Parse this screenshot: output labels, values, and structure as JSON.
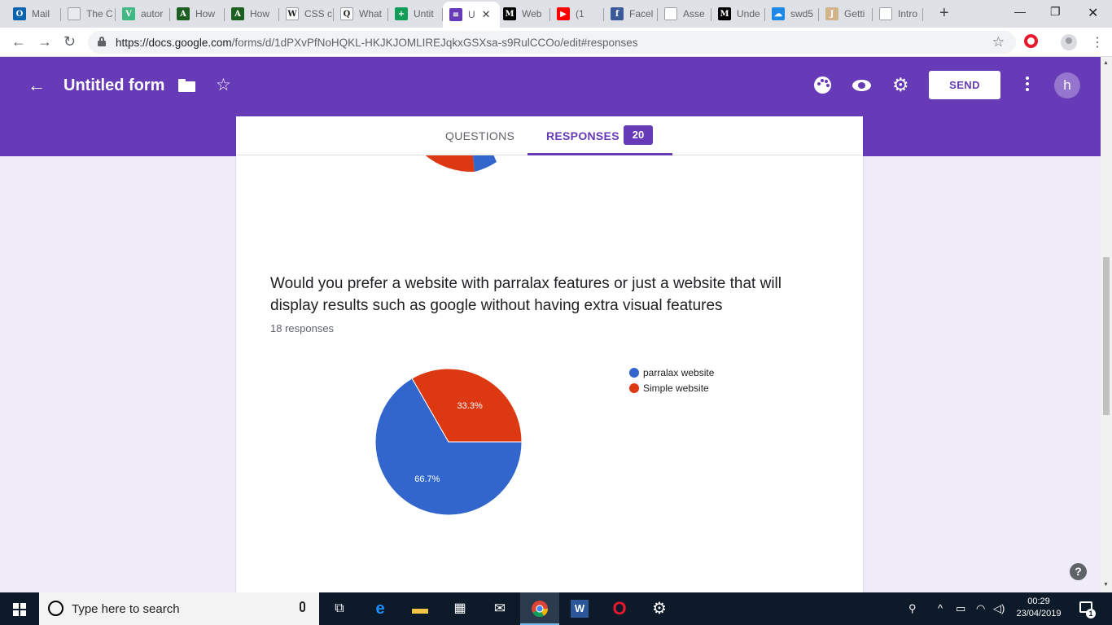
{
  "browser": {
    "tabs": [
      {
        "label": "Mail",
        "icon": "outlook-icon",
        "color": "#0a64ad",
        "glyph": "O"
      },
      {
        "label": "The C",
        "icon": "cursor-icon",
        "color": "#e8eaed",
        "glyph": ""
      },
      {
        "label": "autor",
        "icon": "vue-icon",
        "color": "#41b883",
        "glyph": "V"
      },
      {
        "label": "How",
        "icon": "android-icon",
        "color": "#1b5e20",
        "glyph": "A"
      },
      {
        "label": "How",
        "icon": "android-icon",
        "color": "#1b5e20",
        "glyph": "A"
      },
      {
        "label": "CSS c",
        "icon": "wikipedia-icon",
        "color": "#ffffff",
        "glyph": "W"
      },
      {
        "label": "What",
        "icon": "quora-icon",
        "color": "#ffffff",
        "glyph": "Q"
      },
      {
        "label": "Untit",
        "icon": "sheets-icon",
        "color": "#0f9d58",
        "glyph": "+"
      },
      {
        "label": "U",
        "icon": "forms-icon",
        "color": "#673ab7",
        "glyph": "≡",
        "active": true
      },
      {
        "label": "Web",
        "icon": "medium-icon",
        "color": "#000000",
        "glyph": "M"
      },
      {
        "label": "(1",
        "icon": "youtube-icon",
        "color": "#ff0000",
        "glyph": "▶"
      },
      {
        "label": "Facel",
        "icon": "facebook-icon",
        "color": "#3b5998",
        "glyph": "f"
      },
      {
        "label": "Asse",
        "icon": "document-icon",
        "color": "#ffffff",
        "glyph": ""
      },
      {
        "label": "Unde",
        "icon": "medium-icon",
        "color": "#000000",
        "glyph": "M"
      },
      {
        "label": "swd5",
        "icon": "cloud-icon",
        "color": "#1e88e5",
        "glyph": "☁"
      },
      {
        "label": "Getti",
        "icon": "jenkins-icon",
        "color": "#d2b48c",
        "glyph": "J"
      },
      {
        "label": "Intro",
        "icon": "document-icon",
        "color": "#ffffff",
        "glyph": ""
      }
    ],
    "new_tab": "+",
    "url_host": "https://docs.google.com",
    "url_path": "/forms/d/1dPXvPfNoHQKL-HKJKJOMLIREJqkxGSXsa-s9RulCCOo/edit#responses"
  },
  "forms": {
    "title": "Untitled form",
    "send_label": "SEND",
    "avatar_initial": "h",
    "tab_questions": "QUESTIONS",
    "tab_responses": "RESPONSES",
    "responses_count": "20",
    "question": "Would you prefer a website with parralax features or just a website that will display results such as google without having extra visual features",
    "response_summary": "18 responses",
    "chart_data": {
      "type": "pie",
      "labels": [
        "parralax website",
        "Simple website"
      ],
      "values": [
        66.7,
        33.3
      ],
      "data_labels": [
        "66.7%",
        "33.3%"
      ],
      "colors": [
        "#3366cc",
        "#dc3912"
      ],
      "legend_position": "right"
    }
  },
  "taskbar": {
    "search_placeholder": "Type here to search",
    "time": "00:29",
    "date": "23/04/2019",
    "notification_count": "1"
  }
}
